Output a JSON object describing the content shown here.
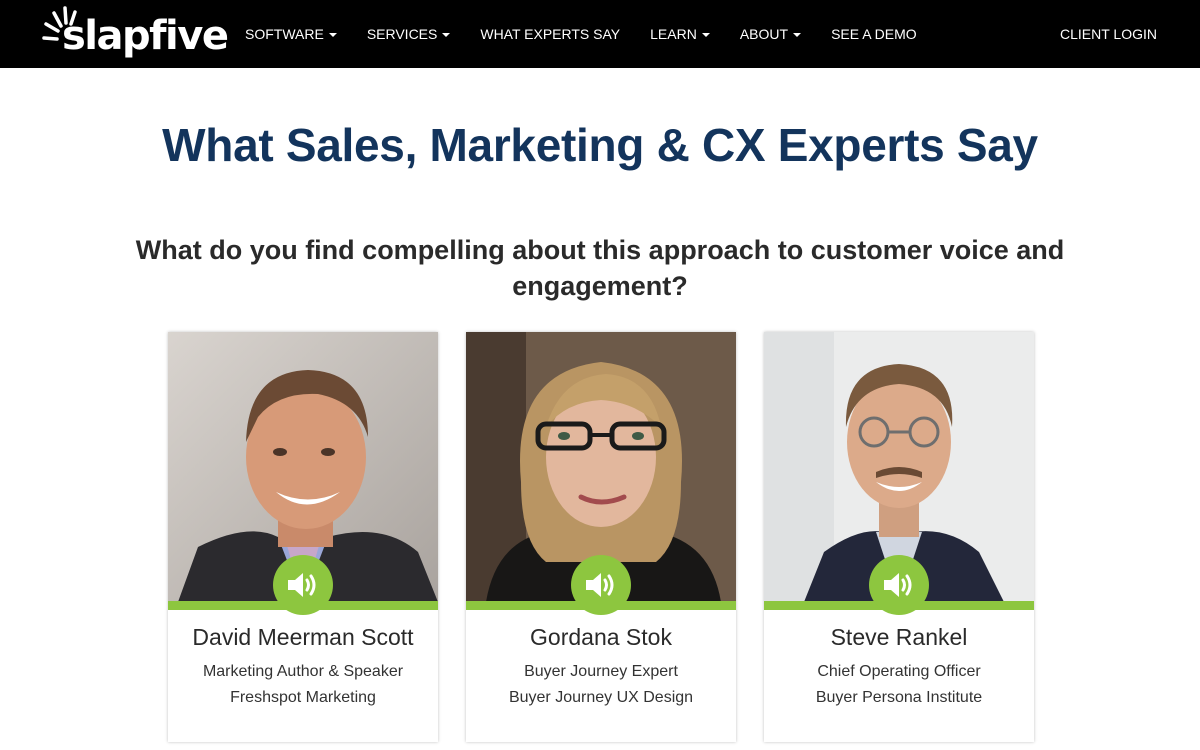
{
  "brand": {
    "name": "slapfive",
    "accent": "#8dc63f",
    "title_color": "#13345c"
  },
  "nav": {
    "items": [
      {
        "label": "SOFTWARE",
        "dropdown": true
      },
      {
        "label": "SERVICES",
        "dropdown": true
      },
      {
        "label": "WHAT EXPERTS SAY",
        "dropdown": false
      },
      {
        "label": "LEARN",
        "dropdown": true
      },
      {
        "label": "ABOUT",
        "dropdown": true
      },
      {
        "label": "SEE A DEMO",
        "dropdown": false
      }
    ],
    "client_login": "CLIENT LOGIN"
  },
  "page": {
    "title": "What Sales, Marketing & CX Experts Say",
    "question_line1": "What do you find compelling about this approach to customer voice and",
    "question_line2": "engagement?"
  },
  "experts": [
    {
      "name": "David Meerman Scott",
      "role": "Marketing Author & Speaker",
      "company": "Freshspot Marketing",
      "icon": "speaker-icon"
    },
    {
      "name": "Gordana Stok",
      "role": "Buyer Journey Expert",
      "company": "Buyer Journey UX Design",
      "icon": "speaker-icon"
    },
    {
      "name": "Steve Rankel",
      "role": "Chief Operating Officer",
      "company": "Buyer Persona Institute",
      "icon": "speaker-icon"
    }
  ]
}
